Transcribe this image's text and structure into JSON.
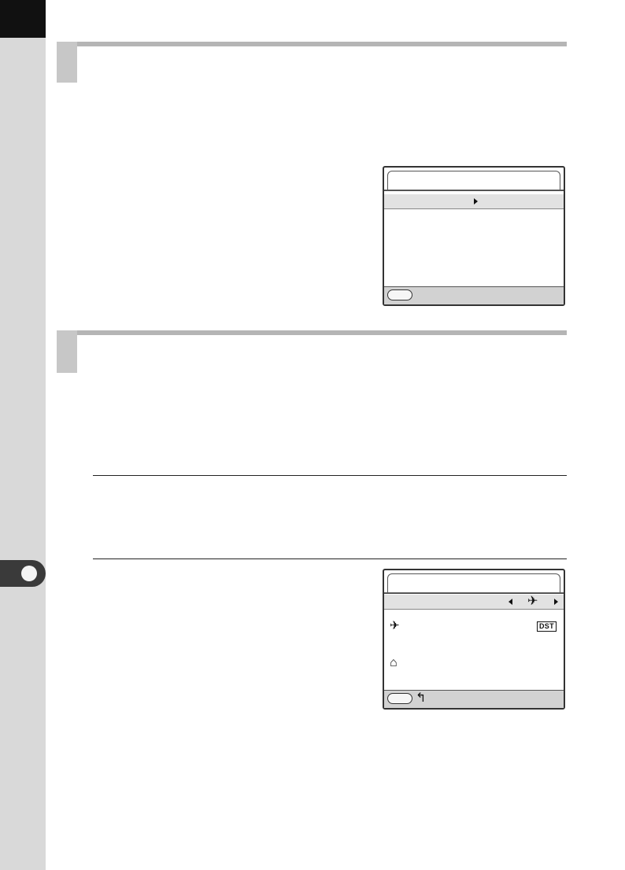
{
  "page": {
    "chapter_number": "",
    "sections": [
      {
        "title": ""
      },
      {
        "title": ""
      }
    ]
  },
  "screen1": {
    "title": "",
    "row_label": "",
    "footer_label": ""
  },
  "screen2": {
    "title": "",
    "row_label": "",
    "destination_glyph": "✈",
    "home_glyph": "⌂",
    "back_glyph": "↰",
    "dst_badge": "DST",
    "footer_label": ""
  },
  "icons": {
    "selected": "airplane-icon",
    "destination": "airplane-icon",
    "home": "home-icon",
    "back": "back-arrow-icon"
  },
  "colors": {
    "side_strip": "#d9d9d9",
    "section_bar": "#b5b5b5",
    "screen_row": "#e2e2e2",
    "screen_footer": "#d2d2d2"
  }
}
